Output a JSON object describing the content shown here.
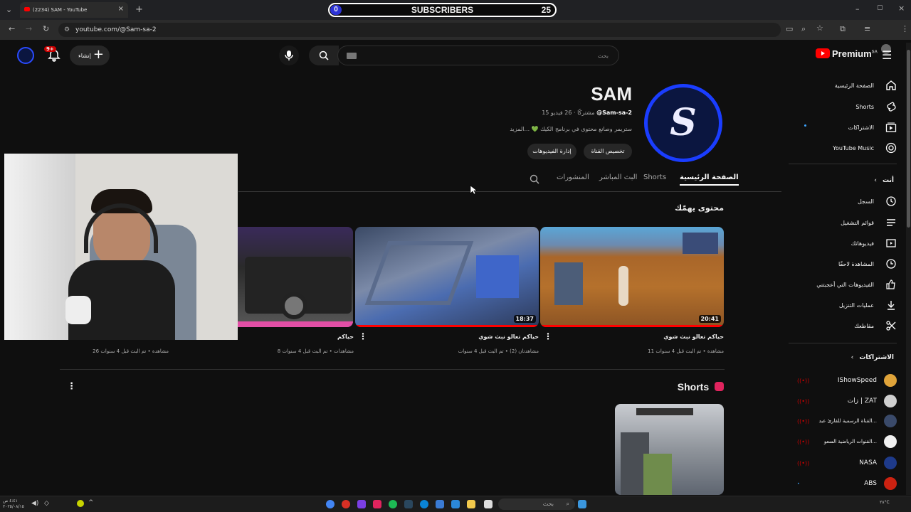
{
  "browser": {
    "tab_title": "(2234) SAM - YouTube",
    "url": "youtube.com/@Sam-sa-2"
  },
  "overlay": {
    "left_count": "0",
    "label": "SUBSCRIBERS",
    "right_count": "25"
  },
  "header": {
    "create_label": "إنشاء",
    "notif_badge": "9+",
    "search_placeholder": "بحث",
    "brand": "Premium",
    "region": "SA"
  },
  "sidebar": {
    "main": [
      {
        "label": "الصفحة الرئيسية",
        "icon": "home-icon"
      },
      {
        "label": "Shorts",
        "icon": "shorts-icon"
      },
      {
        "label": "الاشتراكات",
        "icon": "subscriptions-icon"
      },
      {
        "label": "YouTube Music",
        "icon": "music-icon"
      }
    ],
    "you_heading": "أنت",
    "you": [
      {
        "label": "السجل",
        "icon": "history-icon"
      },
      {
        "label": "قوائم التشغيل",
        "icon": "playlists-icon"
      },
      {
        "label": "فيديوهاتك",
        "icon": "your-videos-icon"
      },
      {
        "label": "المشاهدة لاحقًا",
        "icon": "watch-later-icon"
      },
      {
        "label": "الفيديوهات التي أعجبتني",
        "icon": "liked-icon"
      },
      {
        "label": "عمليات التنزيل",
        "icon": "download-icon"
      },
      {
        "label": "مقاطعك",
        "icon": "clips-icon"
      }
    ],
    "subs_heading": "الاشتراكات",
    "subscriptions": [
      {
        "name": "IShowSpeed",
        "color": "#e0a43a"
      },
      {
        "name": "زات | ZAT",
        "color": "#cfcfcf"
      },
      {
        "name": "القناة الرسمية للقارئ عبد...",
        "color": "#3a4a6a"
      },
      {
        "name": "القنوات الرياضية السعو...",
        "color": "#f0f0f0"
      },
      {
        "name": "NASA",
        "color": "#1e3a8a"
      },
      {
        "name": "ABS",
        "color": "#c21"
      }
    ]
  },
  "channel": {
    "name": "SAM",
    "handle": "@Sam-sa-2",
    "stats": "15 مشتركًا · 26 فيديو",
    "description": "ستريمر وصانع محتوى في برنامج الكيك 💚 ...المزيد",
    "customize_button": "تخصيص القناة",
    "manage_button": "إدارة الفيديوهات",
    "tabs": [
      "الصفحة الرئيسية",
      "Shorts",
      "البث المباشر",
      "المنشورات"
    ]
  },
  "sections": {
    "for_you": "محتوى يهمّك",
    "shorts": "Shorts"
  },
  "videos": [
    {
      "title": "حياكم تعالو نبث شوي",
      "meta": "11 مشاهدة • تم البث قبل 4 سنوات",
      "duration": "20:41"
    },
    {
      "title": "حياكم تعالو نبث شوي",
      "meta": "مشاهدتان (2) • تم البث قبل 4 سنوات",
      "duration": "18:37"
    },
    {
      "title": "حياكم",
      "meta": "8 مشاهدات • تم البث قبل 4 سنوات",
      "duration": ""
    },
    {
      "title": "",
      "meta": "26 مشاهدة • تم البث قبل 4 سنوات",
      "duration": ""
    }
  ],
  "taskbar": {
    "search_placeholder": "بحث",
    "time": "٤:٤١ ص",
    "date": "٢٠٢٥/٠٨/١٥",
    "weather": "٢٨°C"
  }
}
